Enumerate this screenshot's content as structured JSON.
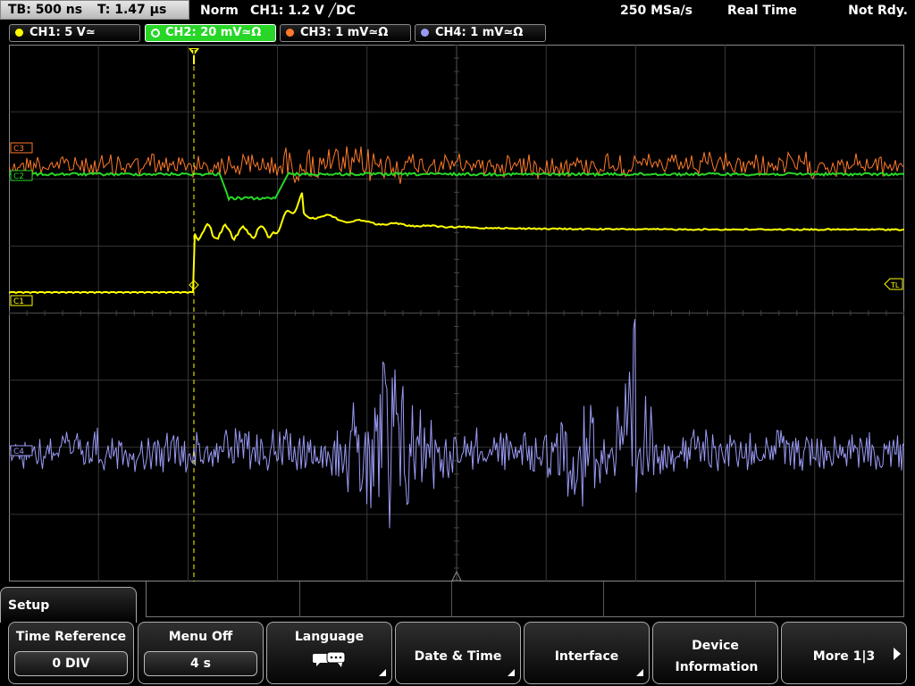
{
  "top": {
    "timebase": "TB: 500 ns",
    "trigger_time": "T: 1.47 µs",
    "trigger_mode": "Norm",
    "trigger_info": "CH1: 1.2 V ╱DC",
    "sample_rate": "250 MSa/s",
    "acq_mode": "Real Time",
    "status": "Not Rdy."
  },
  "channels": [
    {
      "label": "CH1: 5 V≃",
      "color": "#ffff00"
    },
    {
      "label": "CH2: 20 mV≃Ω",
      "color": "#27d627",
      "active": true
    },
    {
      "label": "CH3: 1 mV≃Ω",
      "color": "#ff7a2a"
    },
    {
      "label": "CH4: 1 mV≃Ω",
      "color": "#9a9af5"
    }
  ],
  "markers": {
    "c3": "C3",
    "c2": "C2",
    "c1": "C1",
    "c4": "C4",
    "trigger_level": "TL",
    "trigger_pos": "T"
  },
  "menu": {
    "title": "Setup",
    "softkeys": [
      {
        "title": "Time Reference",
        "value": "0 DIV"
      },
      {
        "title": "Menu Off",
        "value": "4 s"
      },
      {
        "title": "Language"
      },
      {
        "title": "Date & Time"
      },
      {
        "title": "Interface"
      },
      {
        "title": "Device Information"
      },
      {
        "title": "More 1|3"
      }
    ]
  },
  "colors": {
    "ch1": "#ffff00",
    "ch2": "#27d627",
    "ch3": "#ff7a2a",
    "ch4": "#9a9af5",
    "grid": "#444444"
  }
}
